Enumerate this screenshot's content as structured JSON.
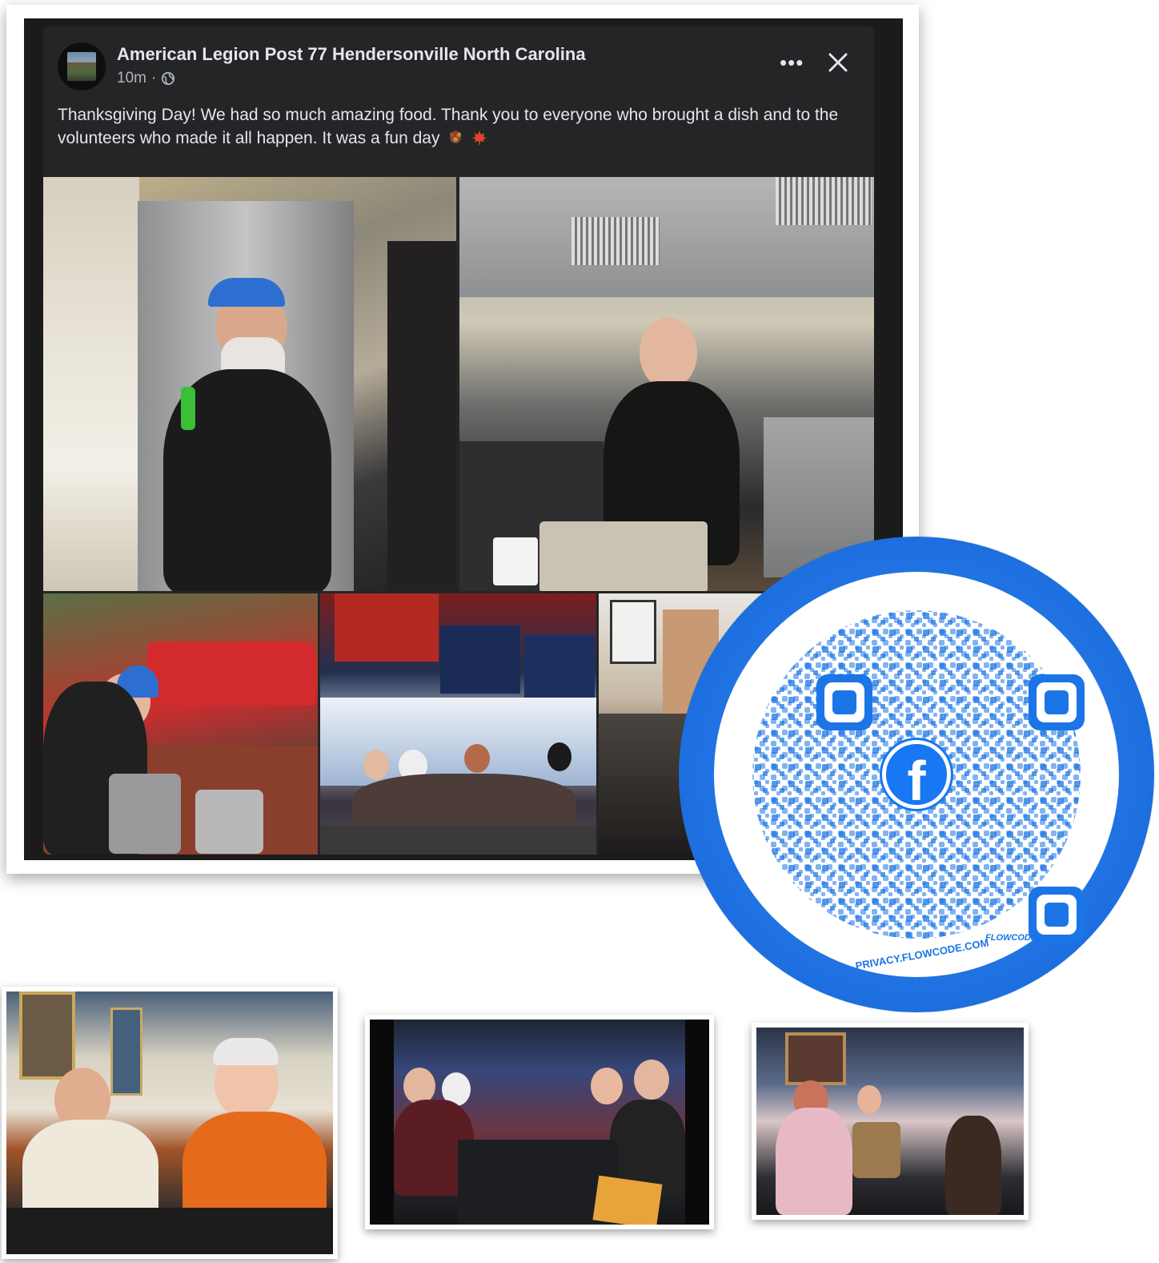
{
  "post": {
    "page_name": "American Legion Post 77 Hendersonville North Carolina",
    "time_ago": "10m",
    "separator": "·",
    "text": "Thanksgiving Day! We had so much amazing food. Thank you to everyone who brought a dish and to the volunteers who made it all happen. It was a fun day",
    "emojis": [
      "turkey-emoji",
      "maple-leaf-emoji"
    ],
    "more_label": "•••",
    "icons": {
      "more": "more-options-icon",
      "close": "close-icon",
      "audience": "globe-icon"
    },
    "photos": [
      "photo-kitchen-man-blue-cap",
      "photo-kitchen-man-gloves",
      "photo-outdoor-cooker",
      "photo-bar-flags-crowd",
      "photo-dining-room"
    ]
  },
  "qr": {
    "center_icon": "facebook-logo-icon",
    "center_letter": "f",
    "brand_label": "FLOWCODE",
    "privacy_label": "PRIVACY.FLOWCODE.COM",
    "colors": {
      "ring": "#1d6fe0",
      "modules": "#1b75e6",
      "facebook": "#1877f2"
    }
  },
  "snapshots": [
    "snapshot-two-men-table",
    "snapshot-group-table",
    "snapshot-women-bar"
  ],
  "colors": {
    "card_bg": "#242526",
    "text_primary": "#e4e6eb",
    "text_secondary": "#b0b3b8"
  }
}
